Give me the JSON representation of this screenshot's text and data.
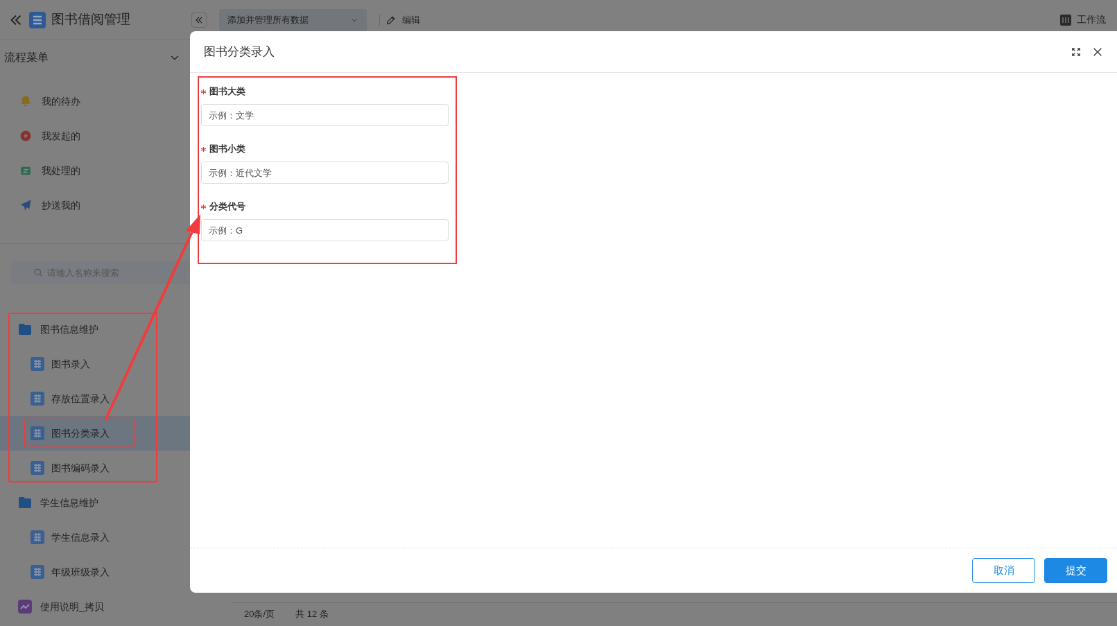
{
  "top_bar": {
    "app_title": "图书借阅管理",
    "data_select": "添加并管理所有数据",
    "edit_button": "编辑",
    "workflow_button": "工作流"
  },
  "sidebar": {
    "section_title": "流程菜单",
    "process_items": [
      {
        "label": "我的待办",
        "kind": "bell"
      },
      {
        "label": "我发起的",
        "kind": "play"
      },
      {
        "label": "我处理的",
        "kind": "inbox"
      },
      {
        "label": "抄送我的",
        "kind": "send"
      }
    ],
    "search": {
      "placeholder": "请输入名称来搜索"
    },
    "tree": [
      {
        "label": "图书信息维护",
        "kind": "folder",
        "children": [
          {
            "label": "图书录入",
            "selected": false
          },
          {
            "label": "存放位置录入",
            "selected": false
          },
          {
            "label": "图书分类录入",
            "selected": true
          },
          {
            "label": "图书编码录入",
            "selected": false
          }
        ]
      },
      {
        "label": "学生信息维护",
        "kind": "folder",
        "children": [
          {
            "label": "学生信息录入",
            "selected": false
          },
          {
            "label": "年级班级录入",
            "selected": false
          }
        ]
      },
      {
        "label": "使用说明_拷贝",
        "kind": "chart"
      }
    ]
  },
  "pagination": {
    "page_size": "20条/页",
    "total": "共 12 条"
  },
  "dialog": {
    "title": "图书分类录入",
    "fields": [
      {
        "label": "图书大类",
        "required": true,
        "placeholder": "示例：文学"
      },
      {
        "label": "图书小类",
        "required": true,
        "placeholder": "示例：近代文学"
      },
      {
        "label": "分类代号",
        "required": true,
        "placeholder": "示例：G"
      }
    ],
    "buttons": [
      {
        "label": "取消",
        "kind": "secondary"
      },
      {
        "label": "提交",
        "kind": "primary"
      }
    ]
  }
}
